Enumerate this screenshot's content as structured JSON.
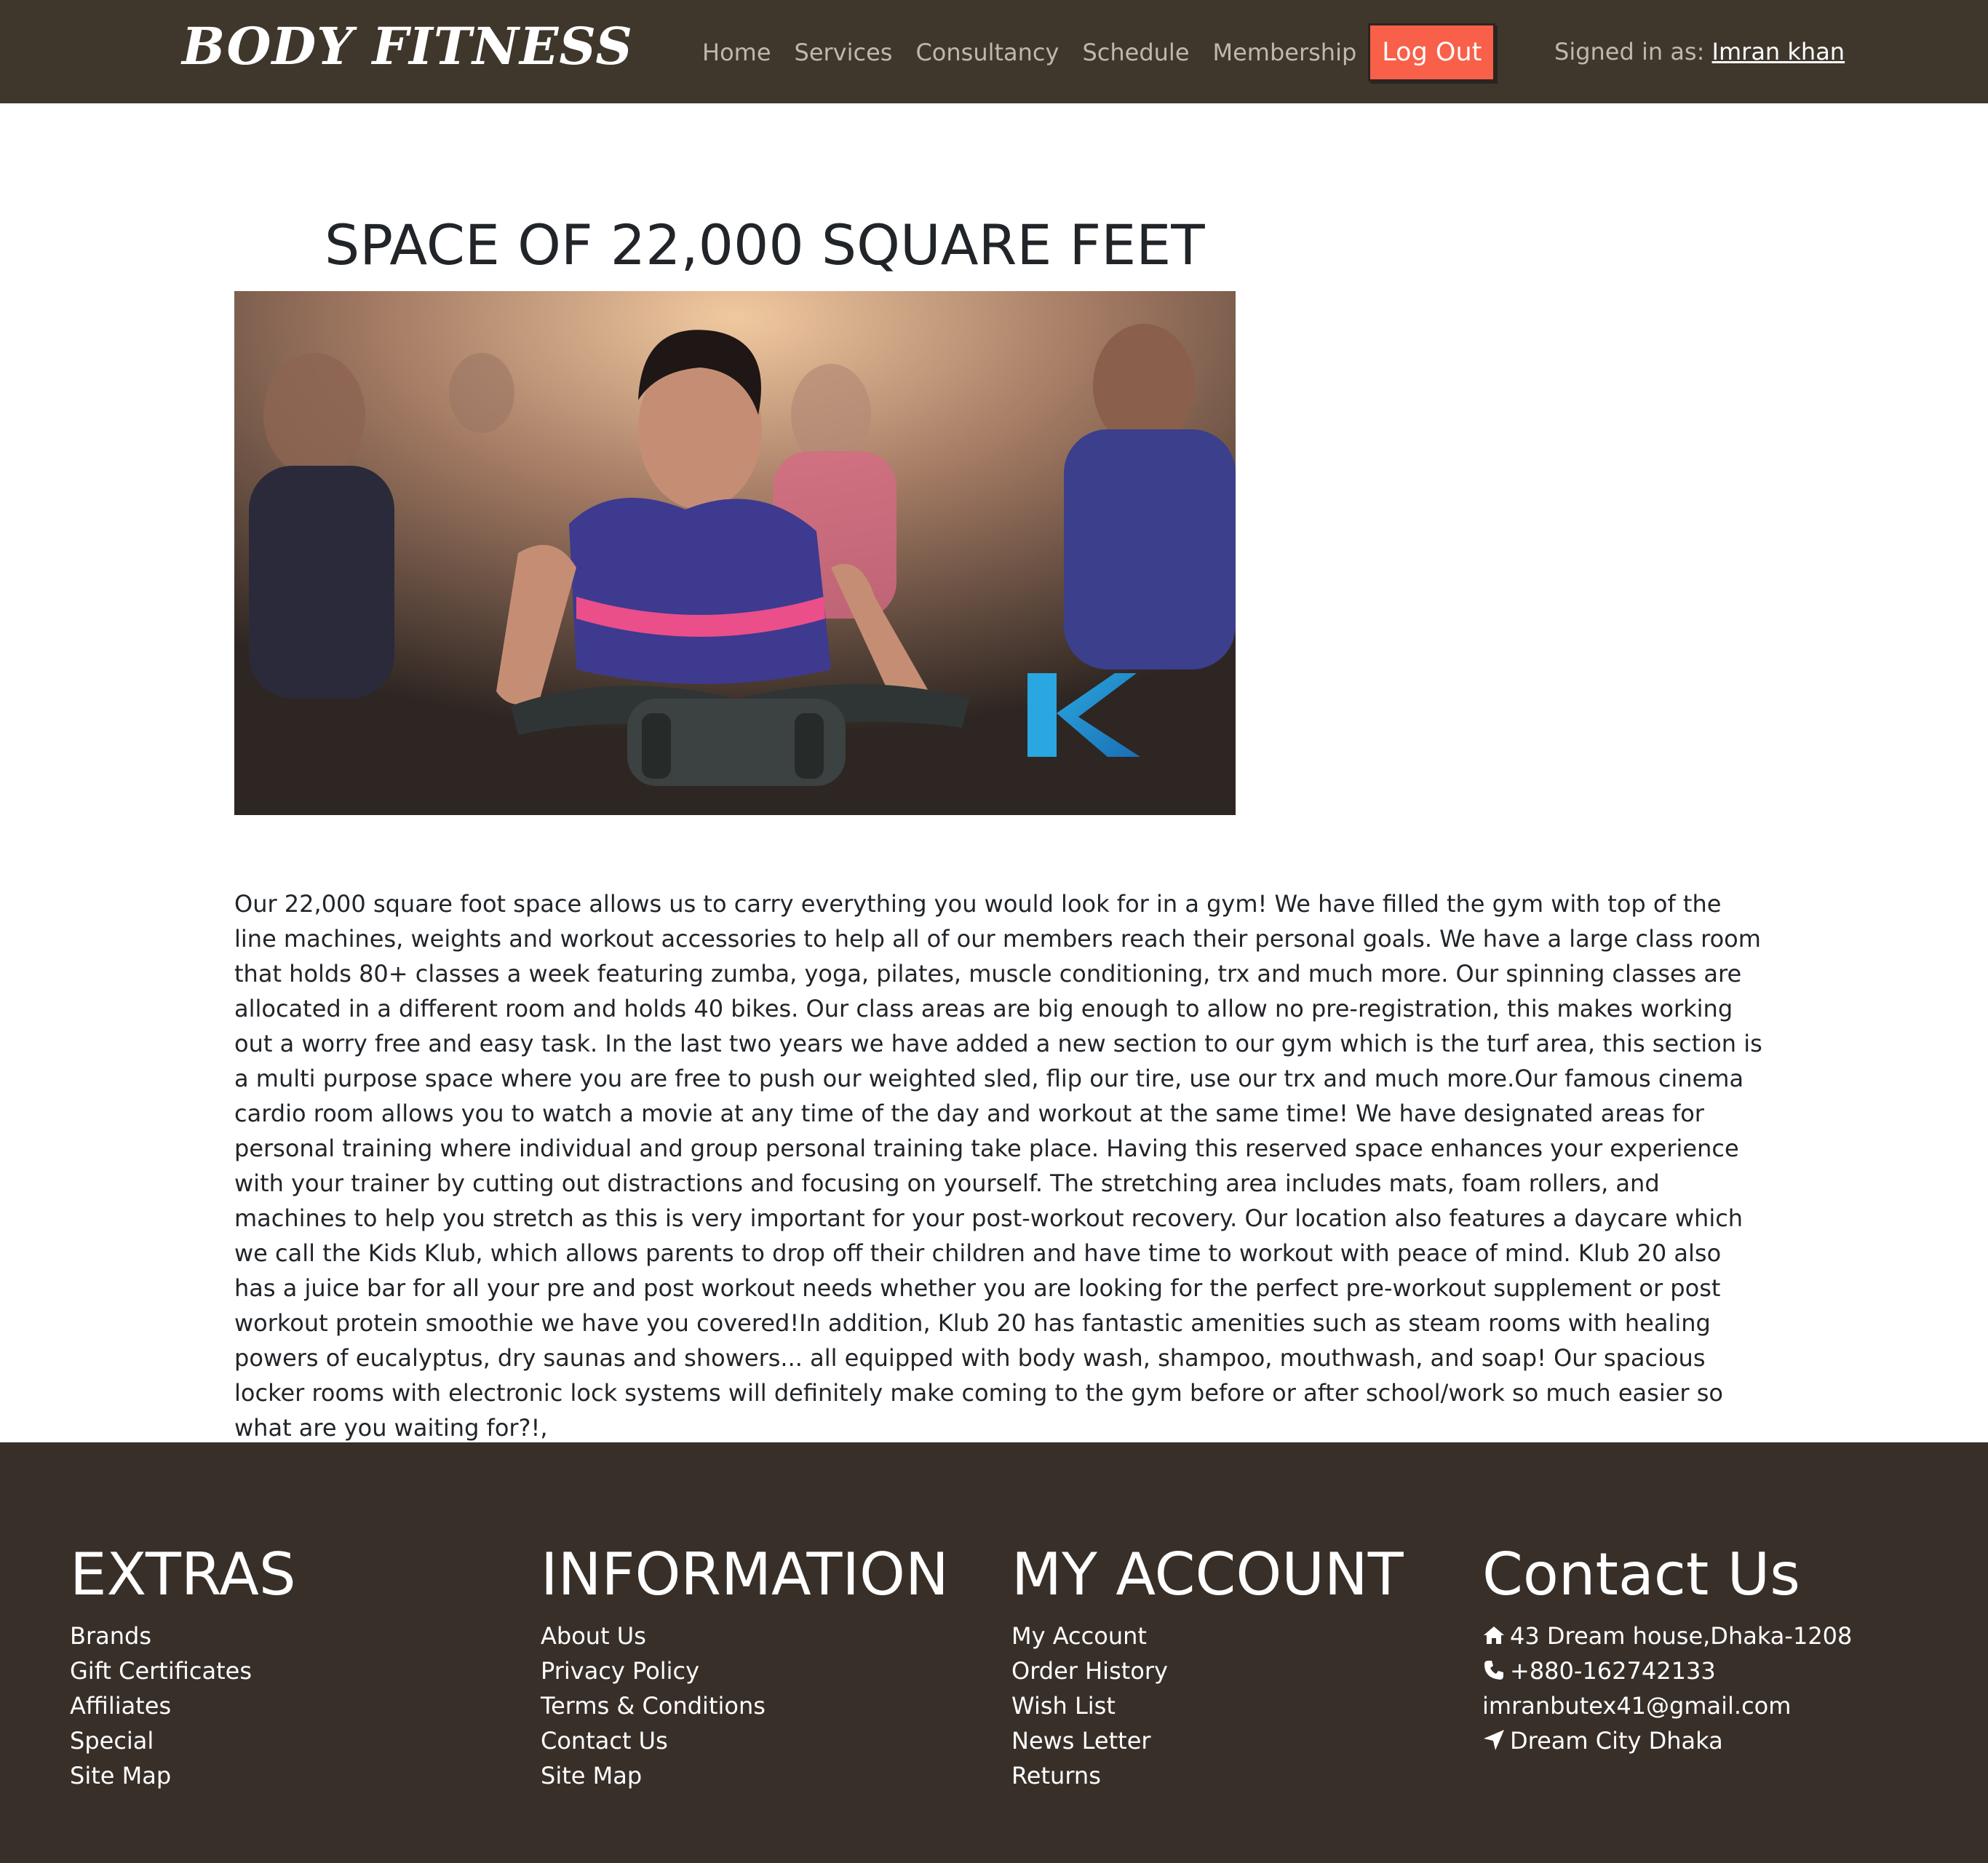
{
  "navbar": {
    "brand": "BODY FITNESS",
    "links": [
      {
        "label": "Home"
      },
      {
        "label": "Services"
      },
      {
        "label": "Consultancy"
      },
      {
        "label": "Schedule"
      },
      {
        "label": "Membership"
      }
    ],
    "logout_label": "Log Out",
    "signed_in_prefix": "Signed in as: ",
    "user_name": "Imran khan"
  },
  "main": {
    "title": "SPACE OF 22,000 SQUARE FEET",
    "image_icon": "gym-spin-class-photo",
    "body": "Our 22,000 square foot space allows us to carry everything you would look for in a gym! We have filled the gym with top of the line machines, weights and workout accessories to help all of our members reach their personal goals. We have a large class room that holds 80+ classes a week featuring zumba, yoga, pilates, muscle conditioning, trx and much more. Our spinning classes are allocated in a different room and holds 40 bikes. Our class areas are big enough to allow no pre-registration, this makes working out a worry free and easy task. In the last two years we have added a new section to our gym which is the turf area, this section is a multi purpose space where you are free to push our weighted sled, flip our tire, use our trx and much more.Our famous cinema cardio room allows you to watch a movie at any time of the day and workout at the same time! We have designated areas for personal training where individual and group personal training take place. Having this reserved space enhances your experience with your trainer by cutting out distractions and focusing on yourself. The stretching area includes mats, foam rollers, and machines to help you stretch as this is very important for your post-workout recovery. Our location also features a daycare which we call the Kids Klub, which allows parents to drop off their children and have time to workout with peace of mind. Klub 20 also has a juice bar for all your pre and post workout needs whether you are looking for the perfect pre-workout supplement or post workout protein smoothie we have you covered!In addition, Klub 20 has fantastic amenities such as steam rooms with healing powers of eucalyptus, dry saunas and showers... all equipped with body wash, shampoo, mouthwash, and soap! Our spacious locker rooms with electronic lock systems will definitely make coming to the gym before or after school/work so much easier so what are you waiting for?!,"
  },
  "footer": {
    "extras": {
      "title": "EXTRAS",
      "items": [
        "Brands",
        "Gift Certificates",
        "Affiliates",
        "Special",
        "Site Map"
      ]
    },
    "information": {
      "title": "INFORMATION",
      "items": [
        "About Us",
        "Privacy Policy",
        "Terms & Conditions",
        "Contact Us",
        "Site Map"
      ]
    },
    "account": {
      "title": "MY ACCOUNT",
      "items": [
        "My Account",
        "Order History",
        "Wish List",
        "News Letter",
        "Returns"
      ]
    },
    "contact": {
      "title": "Contact Us",
      "address": "43 Dream house,Dhaka-1208",
      "address_icon": "home-icon",
      "phone": "+880-162742133",
      "phone_icon": "phone-icon",
      "email": "imranbutex41@gmail.com",
      "location": "Dream City Dhaka",
      "location_icon": "location-arrow-icon"
    }
  },
  "colors": {
    "navbar_bg": "#3f372c",
    "footer_bg": "#382f28",
    "logout_bg": "#f8604a",
    "nav_text": "#bdb8b0"
  }
}
